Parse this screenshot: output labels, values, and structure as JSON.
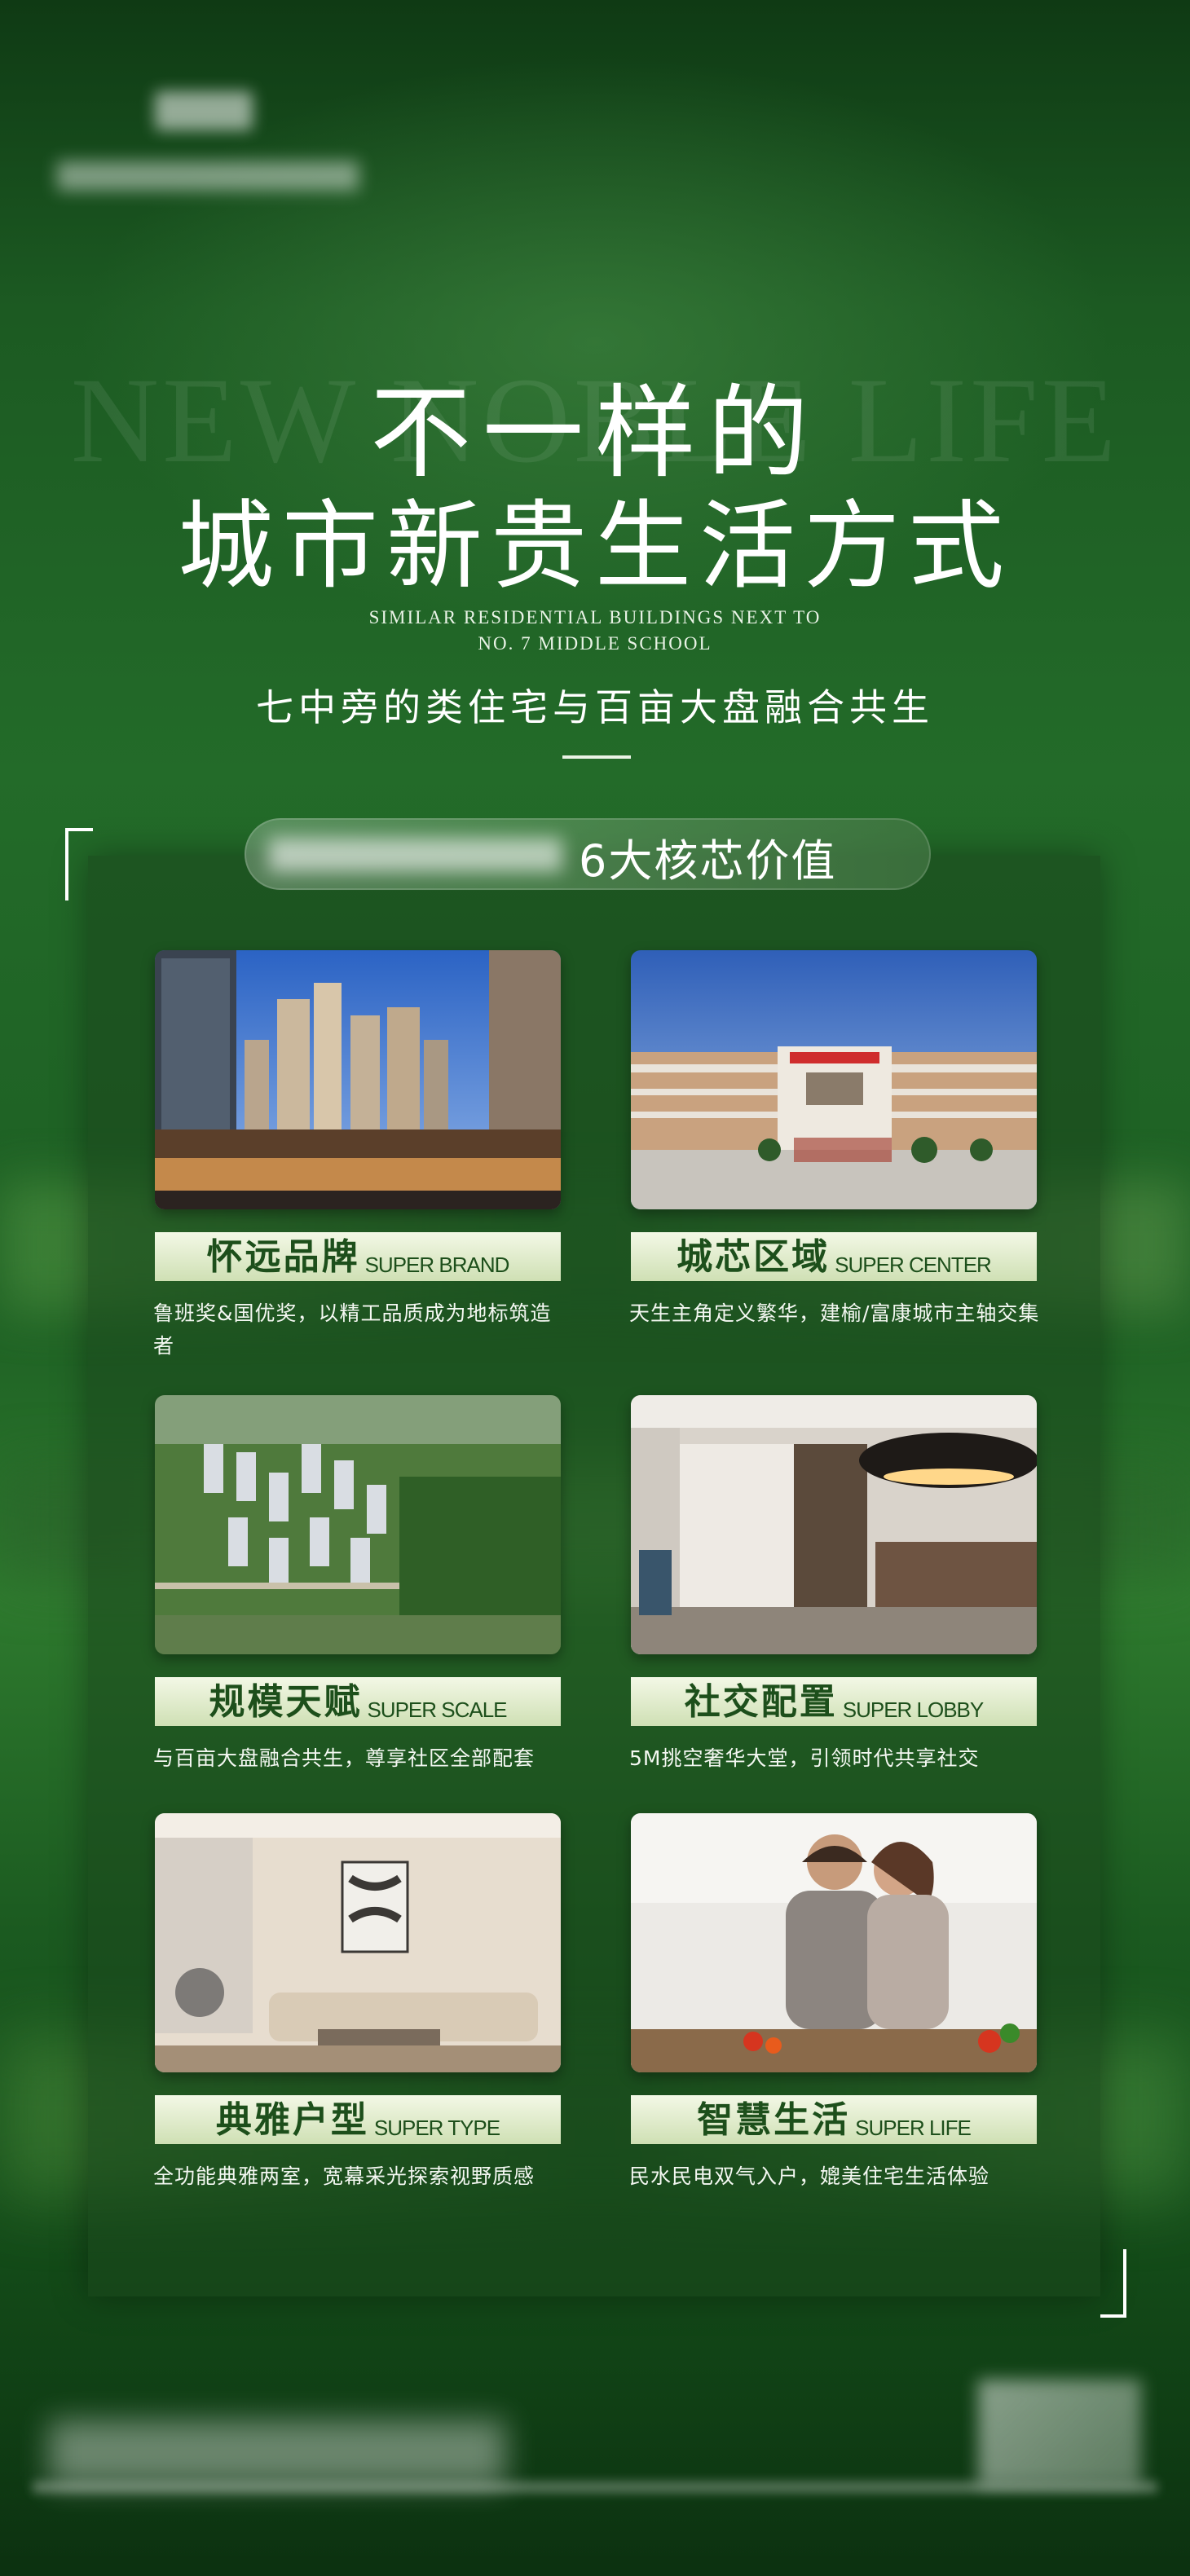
{
  "colors": {
    "accent": "#1d4f1b",
    "label_bg": "#e3eed0",
    "panel": "#1f5a22"
  },
  "hero": {
    "watermark": "NEW NOBLE LIFE",
    "title_line1": "不一样的",
    "title_line2": "城市新贵生活方式",
    "en_line1": "SIMILAR RESIDENTIAL BUILDINGS NEXT TO",
    "en_line2": "NO. 7 MIDDLE SCHOOL",
    "cn_subtitle": "七中旁的类住宅与百亩大盘融合共生"
  },
  "section": {
    "heading": "6大核芯价值"
  },
  "features": [
    {
      "cn": "怀远品牌",
      "en": "SUPER BRAND",
      "desc": "鲁班奖&国优奖，以精工品质成为地标筑造者",
      "image": "city-highrise-street"
    },
    {
      "cn": "城芯区域",
      "en": "SUPER CENTER",
      "desc": "天生主角定义繁华，建榆/富康城市主轴交集",
      "image": "school-building"
    },
    {
      "cn": "规模天赋",
      "en": "SUPER SCALE",
      "desc": "与百亩大盘融合共生，尊享社区全部配套",
      "image": "aerial-community"
    },
    {
      "cn": "社交配置",
      "en": "SUPER LOBBY",
      "desc": "5M挑空奢华大堂，引领时代共享社交",
      "image": "lobby-interior"
    },
    {
      "cn": "典雅户型",
      "en": "SUPER TYPE",
      "desc": "全功能典雅两室，宽幕采光探索视野质感",
      "image": "living-room"
    },
    {
      "cn": "智慧生活",
      "en": "SUPER LIFE",
      "desc": "民水民电双气入户，媲美住宅生活体验",
      "image": "couple-kitchen"
    }
  ]
}
